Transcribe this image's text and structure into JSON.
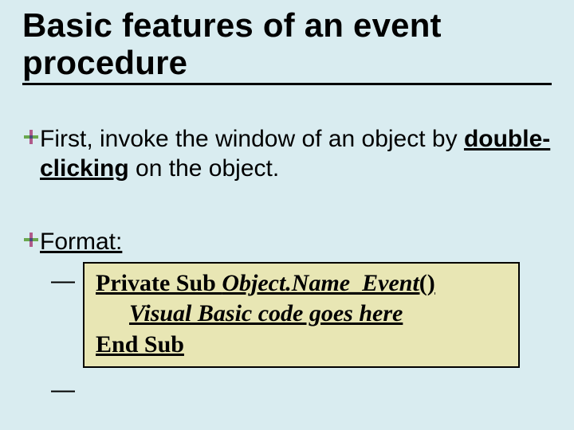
{
  "title": "Basic features of an event procedure",
  "bullet1": {
    "pre": "First, invoke the window of an object by ",
    "bold": "double-clicking",
    "post": " on the object."
  },
  "bullet2": {
    "label": "Format:"
  },
  "code": {
    "l1a": "Private Sub ",
    "l1b": "Object.Name_Event",
    "l1c": "()",
    "l2": "Visual Basic code goes here",
    "l3": "End Sub"
  }
}
